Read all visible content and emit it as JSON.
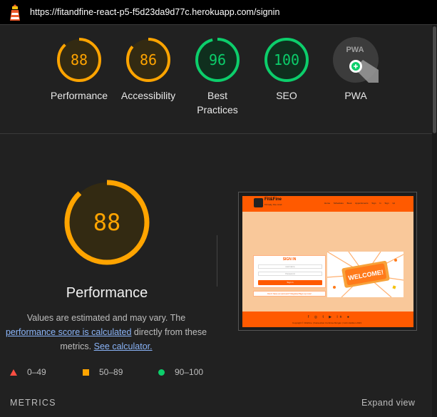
{
  "topbar": {
    "url": "https://fitandfine-react-p5-f5d23da9d77c.herokuapp.com/signin",
    "logo_icon": "lighthouse-icon"
  },
  "gauges": [
    {
      "label": "Performance",
      "score": "88",
      "value": 88,
      "color": "#ffa400",
      "bg": "#332a12"
    },
    {
      "label": "Accessibility",
      "score": "86",
      "value": 86,
      "color": "#ffa400",
      "bg": "#332a12"
    },
    {
      "label": "Best Practices",
      "label_line1": "Best",
      "label_line2": "Practices",
      "score": "96",
      "value": 96,
      "color": "#0cce6b",
      "bg": "#0f2f1e"
    },
    {
      "label": "SEO",
      "score": "100",
      "value": 100,
      "color": "#0cce6b",
      "bg": "#0f2f1e"
    },
    {
      "label": "PWA",
      "badge_text": "PWA",
      "icon": "pwa-badge-icon",
      "color": "#8a8a8a"
    }
  ],
  "main": {
    "score": "88",
    "value": 88,
    "title": "Performance",
    "desc_prefix": "Values are estimated and may vary. The ",
    "desc_link1": "performance score is calculated",
    "desc_middle": " directly from these metrics. ",
    "desc_link2": "See calculator."
  },
  "legend": [
    {
      "label": "0–49",
      "icon": "fail-triangle-icon",
      "color": "#ff4e42"
    },
    {
      "label": "50–89",
      "icon": "average-square-icon",
      "color": "#ffa400"
    },
    {
      "label": "90–100",
      "icon": "pass-circle-icon",
      "color": "#0cce6b"
    }
  ],
  "metrics": {
    "heading": "METRICS",
    "expand": "Expand view"
  },
  "thumbnail": {
    "brand": "Fit&Fine",
    "tagline": "Fit body, fine mind",
    "nav_links": "Home Schedules Book Appointments Sign In Sign Up",
    "signin_title": "SIGN IN",
    "username_placeholder": "username",
    "password_placeholder": "Password",
    "signin_button": "Sign in",
    "no_account": "Don't have an account? Register/Sign up now!",
    "welcome": "WELCOME!",
    "social": "f ◎ t ▶ in ●",
    "copyright": "Copyright © Fit&Fine | Kazeeshan Curtinisa Morgan | Cohm Edition 2023"
  }
}
